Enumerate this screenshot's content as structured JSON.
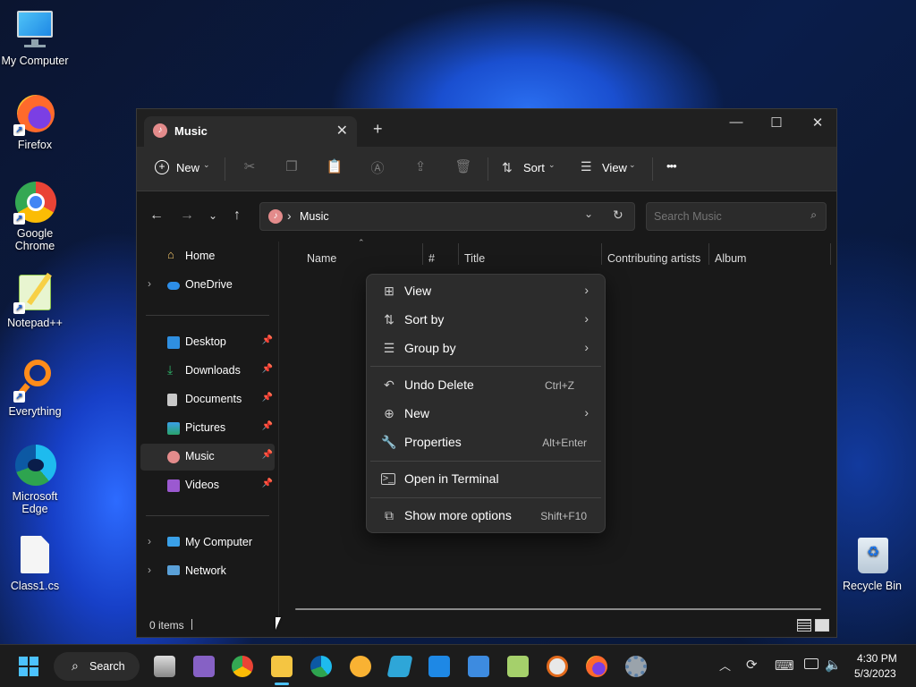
{
  "desktop": {
    "icons": [
      {
        "label": "My Computer"
      },
      {
        "label": "Firefox"
      },
      {
        "label": "Google Chrome"
      },
      {
        "label": "Notepad++"
      },
      {
        "label": "Everything"
      },
      {
        "label": "Microsoft Edge"
      },
      {
        "label": "Class1.cs"
      },
      {
        "label": "Recycle Bin"
      }
    ]
  },
  "window": {
    "tab_title": "Music",
    "toolbar": {
      "new_label": "New",
      "sort_label": "Sort",
      "view_label": "View",
      "more_label": "•••"
    },
    "address": {
      "path": "Music",
      "separator": "›"
    },
    "search": {
      "placeholder": "Search Music"
    },
    "sidebar": {
      "home": "Home",
      "onedrive": "OneDrive",
      "quick_access": [
        {
          "label": "Desktop",
          "color": "#2f8fe0"
        },
        {
          "label": "Downloads",
          "color": "#2fb36a"
        },
        {
          "label": "Documents",
          "color": "#c8c8c8"
        },
        {
          "label": "Pictures",
          "color": "#3aa0e8"
        },
        {
          "label": "Music",
          "color": "#e38b8b"
        },
        {
          "label": "Videos",
          "color": "#9b59d0"
        }
      ],
      "my_computer": "My Computer",
      "network": "Network"
    },
    "columns": [
      "Name",
      "#",
      "Title",
      "Contributing artists",
      "Album"
    ],
    "status": "0 items"
  },
  "context_menu": {
    "items": [
      {
        "label": "View",
        "icon": "grid-icon",
        "submenu": true,
        "key": ""
      },
      {
        "label": "Sort by",
        "icon": "sort-icon",
        "submenu": true,
        "key": ""
      },
      {
        "label": "Group by",
        "icon": "list-icon",
        "submenu": true,
        "key": ""
      },
      {
        "label": "Undo Delete",
        "icon": "undo-icon",
        "submenu": false,
        "key": "Ctrl+Z"
      },
      {
        "label": "New",
        "icon": "plus-circle-icon",
        "submenu": true,
        "key": ""
      },
      {
        "label": "Properties",
        "icon": "wrench-icon",
        "submenu": false,
        "key": "Alt+Enter"
      },
      {
        "label": "Open in Terminal",
        "icon": "terminal-icon",
        "submenu": false,
        "key": ""
      },
      {
        "label": "Show more options",
        "icon": "share-icon",
        "submenu": false,
        "key": "Shift+F10"
      }
    ]
  },
  "taskbar": {
    "search_label": "Search",
    "time": "4:30 PM",
    "date": "5/3/2023"
  }
}
